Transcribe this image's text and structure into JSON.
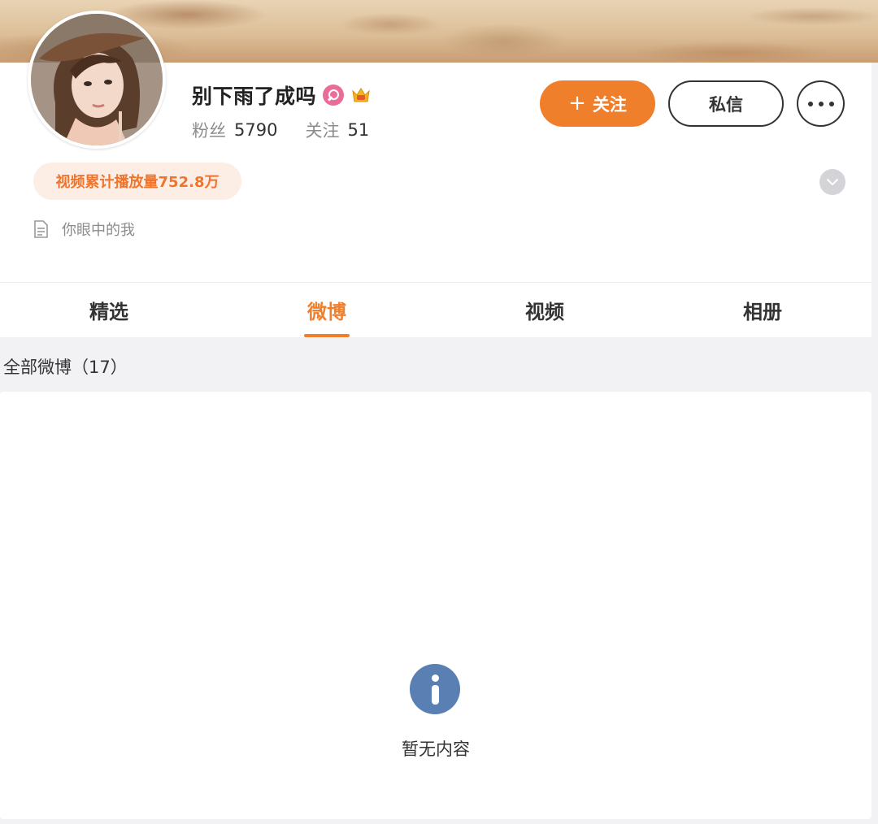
{
  "profile": {
    "name": "别下雨了成吗",
    "fans_label": "粉丝",
    "fans_count": "5790",
    "following_label": "关注",
    "following_count": "51",
    "play_count_text": "视频累计播放量752.8万",
    "bio": "你眼中的我"
  },
  "actions": {
    "follow_plus": "+",
    "follow_label": "关注",
    "message_label": "私信"
  },
  "tabs": [
    {
      "label": "精选",
      "active": false
    },
    {
      "label": "微博",
      "active": true
    },
    {
      "label": "视频",
      "active": false
    },
    {
      "label": "相册",
      "active": false
    }
  ],
  "feed": {
    "header": "全部微博（17）",
    "empty_text": "暂无内容"
  },
  "colors": {
    "accent": "#f07f2c",
    "info_icon": "#5a7fb3",
    "vip_badge": "#e96d98"
  },
  "icons": {
    "badges": [
      "vip-badge-icon",
      "crown-icon"
    ],
    "more": "more-dots-icon",
    "expand": "chevron-down-icon",
    "bio": "document-icon",
    "empty": "info-icon"
  }
}
